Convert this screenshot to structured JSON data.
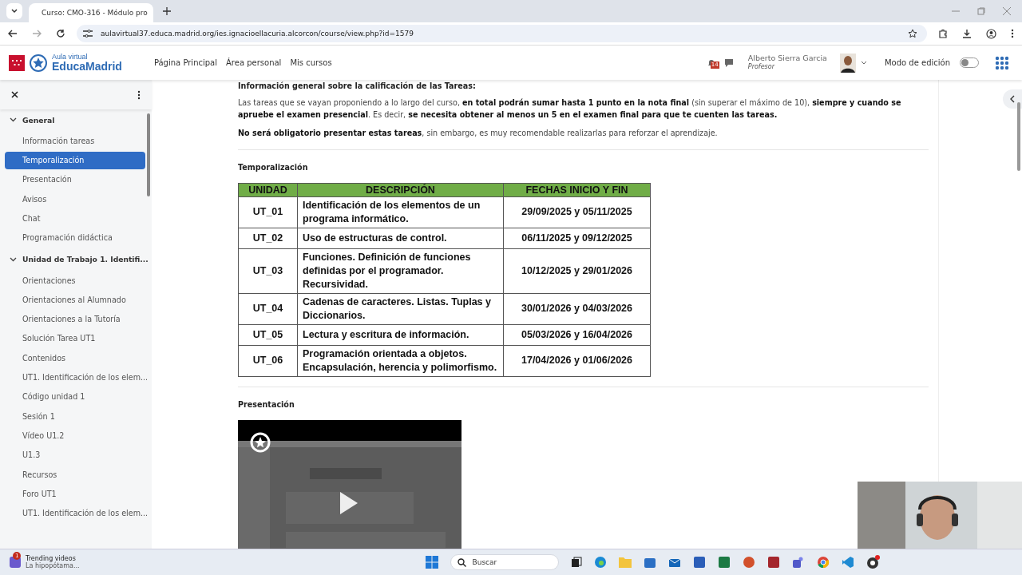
{
  "browser": {
    "tab_title": "Curso: CMO-316 - Módulo pro",
    "url": "aulavirtual37.educa.madrid.org/ies.ignacioellacuria.alcorcon/course/view.php?id=1579"
  },
  "header": {
    "logo_top": "Aula virtual",
    "logo_bottom": "EducaMadrid",
    "nav": [
      "Página Principal",
      "Área personal",
      "Mis cursos"
    ],
    "notifications_badge": "14",
    "user_name": "Alberto Sierra Garcia",
    "user_role": "Profesor",
    "edit_mode": {
      "label": "Modo de edición",
      "on": false
    }
  },
  "sidebar": {
    "sections": [
      {
        "title": "General",
        "expanded": true,
        "items": [
          {
            "label": "Información tareas",
            "selected": false
          },
          {
            "label": "Temporalización",
            "selected": true
          },
          {
            "label": "Presentación",
            "selected": false
          },
          {
            "label": "Avisos",
            "selected": false
          },
          {
            "label": "Chat",
            "selected": false
          },
          {
            "label": "Programación didáctica",
            "selected": false
          }
        ]
      },
      {
        "title": "Unidad de Trabajo 1. Identifi...",
        "expanded": true,
        "items": [
          {
            "label": "Orientaciones",
            "selected": false
          },
          {
            "label": "Orientaciones al Alumnado",
            "selected": false
          },
          {
            "label": "Orientaciones a la Tutoría",
            "selected": false
          },
          {
            "label": "Solución Tarea UT1",
            "selected": false
          },
          {
            "label": "Contenidos",
            "selected": false
          },
          {
            "label": "UT1. Identificación de los elem...",
            "selected": false
          },
          {
            "label": "Código unidad 1",
            "selected": false
          },
          {
            "label": "Sesión 1",
            "selected": false
          },
          {
            "label": "Vídeo U1.2",
            "selected": false
          },
          {
            "label": "U1.3",
            "selected": false
          },
          {
            "label": "Recursos",
            "selected": false
          },
          {
            "label": "Foro UT1",
            "selected": false
          },
          {
            "label": "UT1. Identificación de los elem...",
            "selected": false
          }
        ]
      }
    ]
  },
  "content": {
    "info_heading": "Información general sobre la calificación de las Tareas:",
    "paragraphs": [
      "Las tareas que se vayan proponiendo a lo largo del curso, **en total podrán sumar hasta 1 punto en la nota final** (sin superar el máximo de 10), **siempre y cuando se apruebe el examen presencial**.  Es decir, **se necesita obtener al menos un 5 en el examen final para que te cuenten las tareas.**",
      "**No será obligatorio presentar estas tareas**, sin embargo, es muy recomendable realizarlas para reforzar el aprendizaje."
    ],
    "schedule_heading": "Temporalización",
    "table": {
      "columns": [
        "UNIDAD",
        "DESCRIPCIÓN",
        "FECHAS INICIO Y FIN"
      ],
      "rows": [
        [
          "UT_01",
          "Identificación de los elementos de un programa informático.",
          "29/09/2025 y 05/11/2025"
        ],
        [
          "UT_02",
          "Uso de estructuras de control.",
          "06/11/2025 y 09/12/2025"
        ],
        [
          "UT_03",
          "Funciones. Definición de funciones definidas por el programador. Recursividad.",
          "10/12/2025 y 29/01/2026"
        ],
        [
          "UT_04",
          "Cadenas de caracteres. Listas. Tuplas y Diccionarios.",
          "30/01/2026 y 04/03/2026"
        ],
        [
          "UT_05",
          "Lectura y escritura de información.",
          "05/03/2026 y 16/04/2026"
        ],
        [
          "UT_06",
          "Programación orientada a objetos. Encapsulación, herencia y polimorfismo.",
          "17/04/2026 y 01/06/2026"
        ]
      ]
    },
    "presentation_heading": "Presentación",
    "video": {
      "kind": "picture"
    }
  },
  "taskbar": {
    "widget_badge": "1",
    "widget_title": "Trending videos",
    "widget_subtitle": "La hipopótama...",
    "search_placeholder": "Buscar"
  },
  "webcam": {
    "kind": "picture"
  }
}
